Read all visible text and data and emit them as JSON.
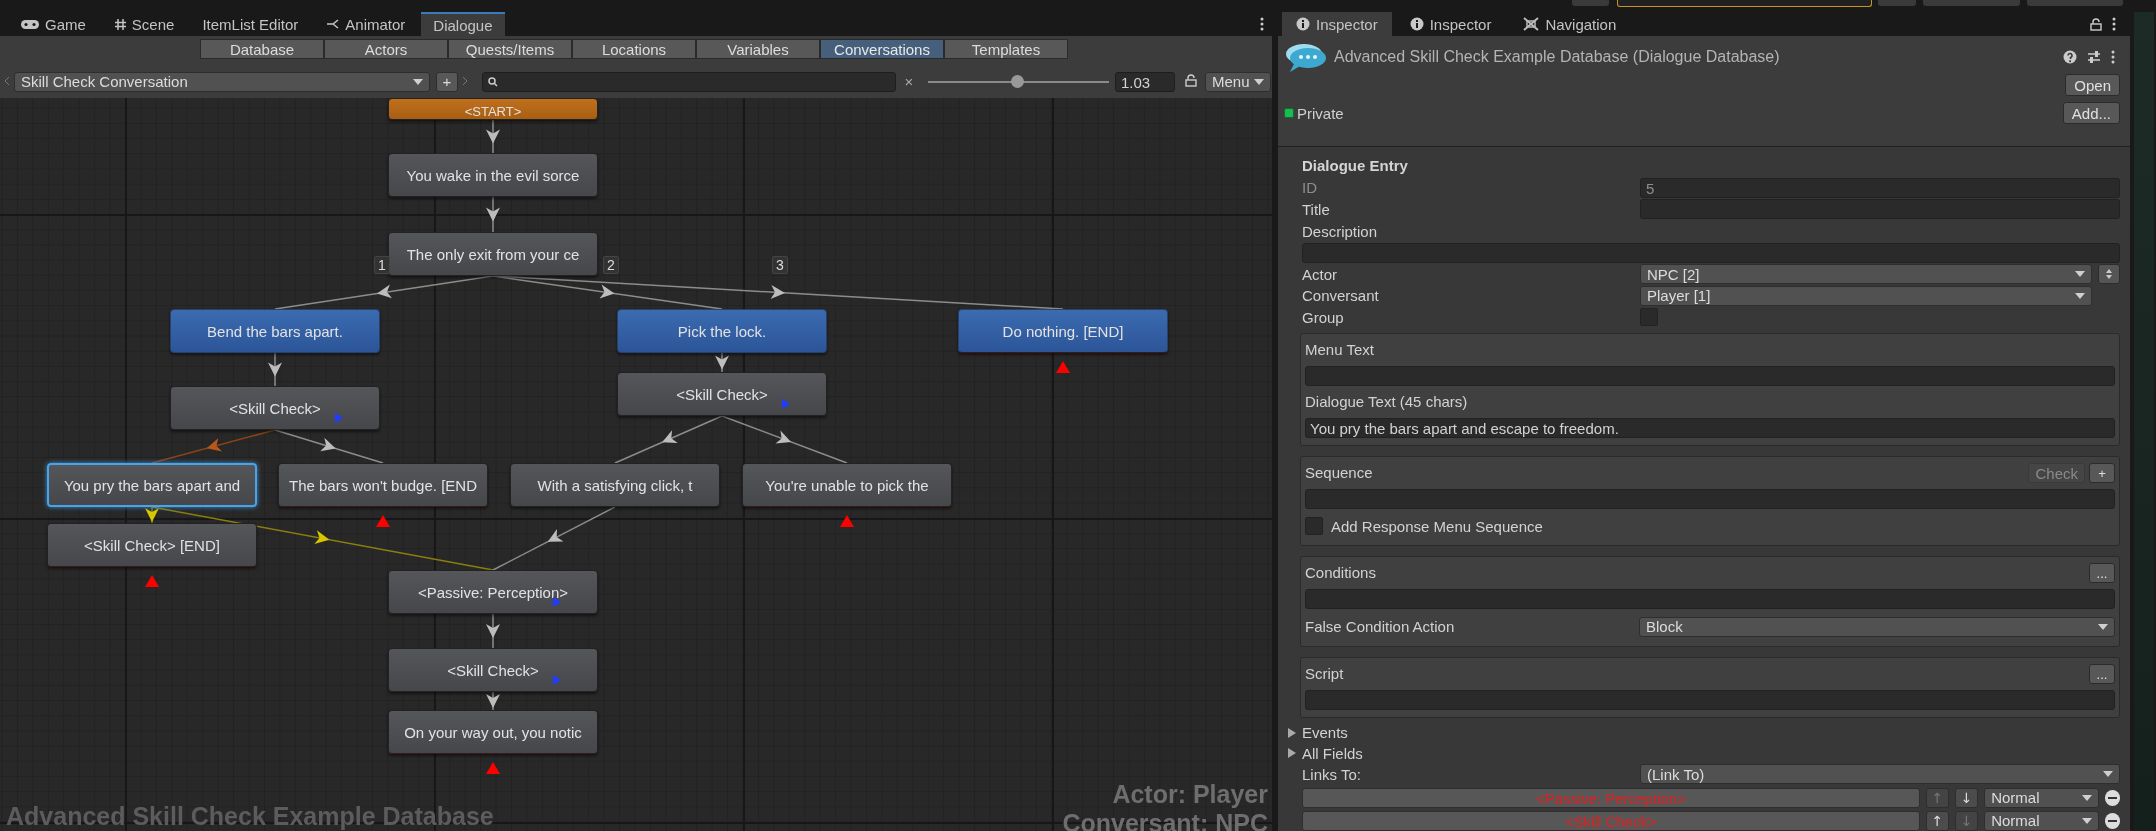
{
  "editor_tabs": [
    {
      "label": "Game",
      "selected": false
    },
    {
      "label": "Scene",
      "selected": false
    },
    {
      "label": "ItemList Editor",
      "selected": false
    },
    {
      "label": "Animator",
      "selected": false
    },
    {
      "label": "Dialogue",
      "selected": true
    }
  ],
  "dialogue_editor": {
    "sections": [
      {
        "label": "Database",
        "selected": false
      },
      {
        "label": "Actors",
        "selected": false
      },
      {
        "label": "Quests/Items",
        "selected": false
      },
      {
        "label": "Locations",
        "selected": false
      },
      {
        "label": "Variables",
        "selected": false
      },
      {
        "label": "Conversations",
        "selected": true
      },
      {
        "label": "Templates",
        "selected": false
      }
    ],
    "conversation": "Skill Check Conversation",
    "add_button": "+",
    "clear_button": "×",
    "zoom": {
      "level": 0.49,
      "value": "1.03"
    },
    "menu": "Menu",
    "canvas": {
      "nodes": [
        {
          "text": "<START>",
          "kind": "start",
          "selected": false,
          "end": false,
          "marker": false
        },
        {
          "text": "You wake in the evil sorce",
          "kind": "npc",
          "selected": false,
          "end": false,
          "marker": false
        },
        {
          "text": "The only exit from your ce",
          "kind": "npc",
          "selected": false,
          "end": false,
          "marker": false
        },
        {
          "text": "Bend the bars apart.",
          "kind": "response",
          "number": "1",
          "selected": false,
          "end": false,
          "marker": false
        },
        {
          "text": "Pick the lock.",
          "kind": "response",
          "number": "2",
          "selected": false,
          "end": false,
          "marker": false
        },
        {
          "text": "Do nothing. [END]",
          "kind": "response",
          "number": "3",
          "selected": false,
          "end": true,
          "marker": false
        },
        {
          "text": "<Skill Check>",
          "kind": "npc",
          "selected": false,
          "end": false,
          "marker": true
        },
        {
          "text": "<Skill Check>",
          "kind": "npc",
          "selected": false,
          "end": false,
          "marker": true
        },
        {
          "text": "You pry the bars apart and",
          "kind": "npc",
          "selected": true,
          "end": false,
          "marker": false
        },
        {
          "text": "The bars won't budge. [END",
          "kind": "npc",
          "selected": false,
          "end": true,
          "marker": false
        },
        {
          "text": "With a satisfying click, t",
          "kind": "npc",
          "selected": false,
          "end": false,
          "marker": false
        },
        {
          "text": "You're unable to pick the",
          "kind": "npc",
          "selected": false,
          "end": true,
          "marker": false
        },
        {
          "text": "<Skill Check> [END]",
          "kind": "npc",
          "selected": false,
          "end": true,
          "marker": false
        },
        {
          "text": "<Passive: Perception>",
          "kind": "npc",
          "selected": false,
          "end": false,
          "marker": true
        },
        {
          "text": "<Skill Check>",
          "kind": "npc",
          "selected": false,
          "end": false,
          "marker": true
        },
        {
          "text": "On your way out, you notic",
          "kind": "npc",
          "selected": false,
          "end": true,
          "marker": false
        }
      ],
      "database_label": "Advanced Skill Check Example Database",
      "actor_label": "Actor: Player",
      "conversant_label": "Conversant: NPC"
    }
  },
  "inspector": {
    "tabs": [
      {
        "label": "Inspector",
        "selected": true
      },
      {
        "label": "Inspector",
        "selected": false
      },
      {
        "label": "Navigation",
        "selected": false
      }
    ],
    "title": "Advanced Skill Check Example Database (Dialogue Database)",
    "open_button": "Open",
    "private": {
      "label": "Private",
      "checked": true
    },
    "add_button": "Add...",
    "section_title": "Dialogue Entry",
    "id": {
      "label": "ID",
      "value": "5",
      "disabled": true
    },
    "title_field": {
      "label": "Title"
    },
    "description": {
      "label": "Description"
    },
    "actor": {
      "label": "Actor",
      "value": "NPC [2]"
    },
    "conversant": {
      "label": "Conversant",
      "value": "Player [1]"
    },
    "group": {
      "label": "Group",
      "checked": false
    },
    "menu_text": {
      "label": "Menu Text"
    },
    "dialogue_text": {
      "label": "Dialogue Text (45 chars)",
      "value": "You pry the bars apart and escape to freedom."
    },
    "sequence": {
      "label": "Sequence",
      "check_button": "Check",
      "add_button": "+"
    },
    "add_response_menu_sequence": {
      "label": "Add Response Menu Sequence",
      "checked": false
    },
    "conditions": {
      "label": "Conditions",
      "more_button": "..."
    },
    "false_condition_action": {
      "label": "False Condition Action",
      "value": "Block"
    },
    "script": {
      "label": "Script",
      "more_button": "..."
    },
    "foldouts": [
      {
        "label": "Events",
        "expanded": false
      },
      {
        "label": "All Fields",
        "expanded": false
      }
    ],
    "links_to": {
      "label": "Links To:",
      "value": "(Link To)"
    },
    "links": [
      {
        "target": "<Passive: Perception>",
        "up_arrow": "↑",
        "down_arrow": "↓",
        "priority": "Normal"
      },
      {
        "target": "<Skill Check>",
        "up_arrow": "↑",
        "down_arrow": "↓",
        "priority": "Normal"
      }
    ]
  }
}
